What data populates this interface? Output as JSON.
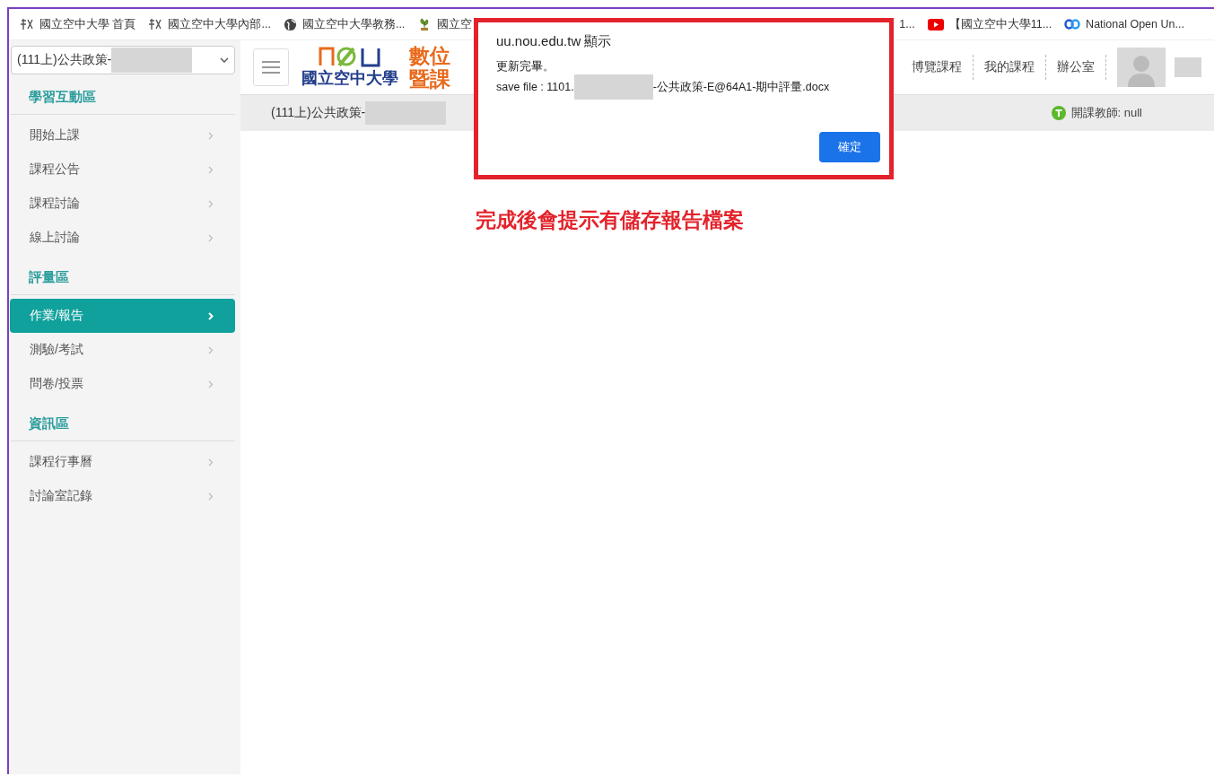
{
  "bookmarks": [
    {
      "label": "國立空中大學 首頁",
      "kind": "seal"
    },
    {
      "label": "國立空中大學內部...",
      "kind": "seal"
    },
    {
      "label": "國立空中大學教務...",
      "kind": "globe"
    },
    {
      "label": "國立空",
      "kind": "plant"
    },
    {
      "label": "1...",
      "kind": "plain"
    },
    {
      "label": "【國立空中大學11...",
      "kind": "video"
    },
    {
      "label": "National Open Un...",
      "kind": "loops"
    }
  ],
  "sidebar": {
    "course_select": {
      "value": "(111上)公共政策-"
    },
    "sections": [
      {
        "title": "學習互動區",
        "items": [
          {
            "label": "開始上課",
            "selected": false
          },
          {
            "label": "課程公告",
            "selected": false
          },
          {
            "label": "課程討論",
            "selected": false
          },
          {
            "label": "線上討論",
            "selected": false
          }
        ]
      },
      {
        "title": "評量區",
        "items": [
          {
            "label": "作業/報告",
            "selected": true
          },
          {
            "label": "測驗/考試",
            "selected": false
          },
          {
            "label": "問卷/投票",
            "selected": false
          }
        ]
      },
      {
        "title": "資訊區",
        "items": [
          {
            "label": "課程行事曆",
            "selected": false
          },
          {
            "label": "討論室記錄",
            "selected": false
          }
        ]
      }
    ]
  },
  "header": {
    "logo_text": "國立空中大學",
    "title_lines": [
      "數位",
      "暨課"
    ],
    "nav": [
      "博覽課程",
      "我的課程",
      "辦公室"
    ]
  },
  "course_bar": {
    "title": "(111上)公共政策-",
    "teacher": "開課教師: null"
  },
  "dialog": {
    "title": "uu.nou.edu.tw 顯示",
    "lines": [
      "更新完畢。",
      "save file : 1101.",
      "-公共政策-E@64A1-期中評量.docx"
    ],
    "button": "確定"
  },
  "annotation": "完成後會提示有儲存報告檔案"
}
